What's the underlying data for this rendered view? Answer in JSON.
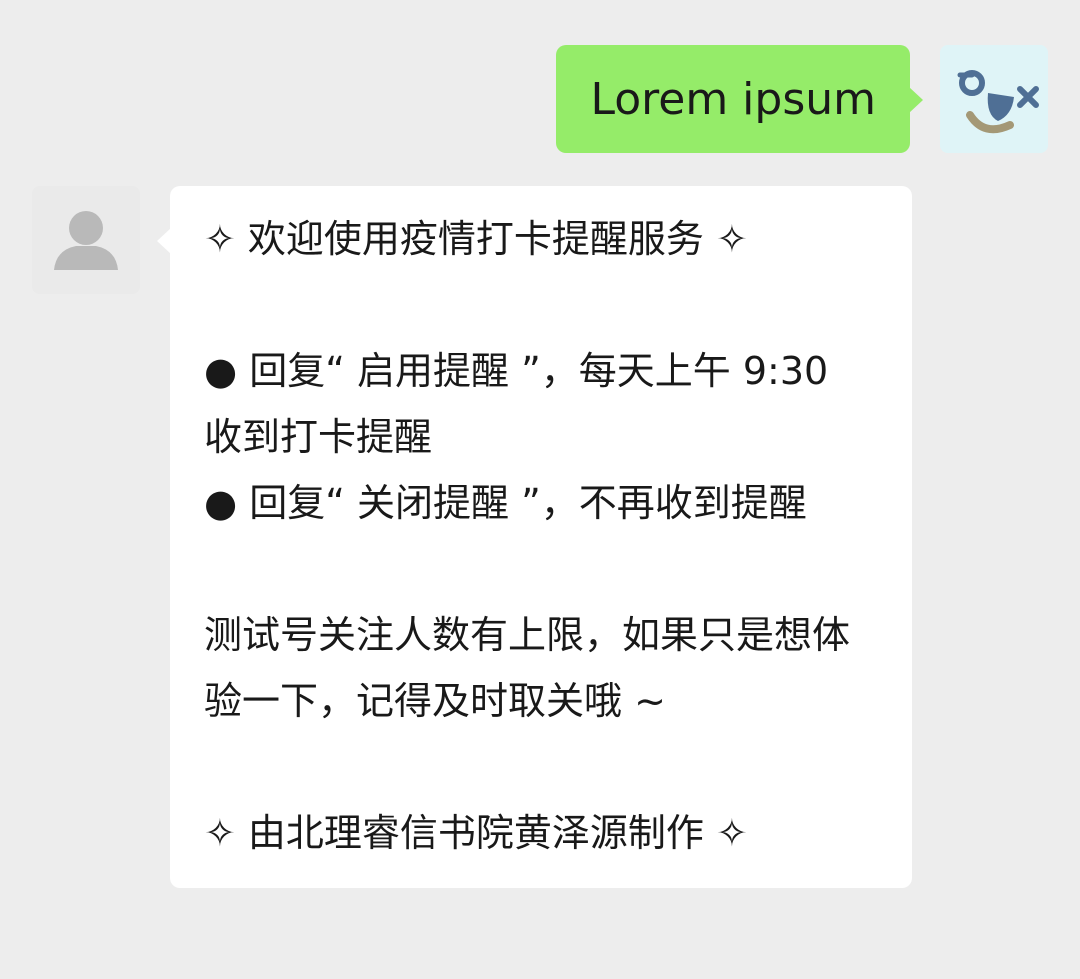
{
  "conversation": {
    "outgoing": {
      "text": "Lorem ipsum",
      "avatar_icon": "user-avatar-logo-icon",
      "bubble_color": "#95ec69"
    },
    "incoming": {
      "avatar_icon": "default-person-icon",
      "bubble_color": "#ffffff",
      "lines": [
        "✧ 欢迎使用疫情打卡提醒服务 ✧",
        "",
        "● 回复“ 启用提醒 ”，每天上午 9:30 收到打卡提醒",
        "● 回复“ 关闭提醒 ”，不再收到提醒",
        "",
        "测试号关注人数有上限，如果只是想体验一下，记得及时取关哦 ~",
        "",
        "✧ 由北理睿信书院黄泽源制作 ✧"
      ]
    }
  },
  "colors": {
    "background": "#ededed",
    "outgoing_bubble": "#95ec69",
    "incoming_bubble": "#ffffff",
    "text": "#191919"
  }
}
